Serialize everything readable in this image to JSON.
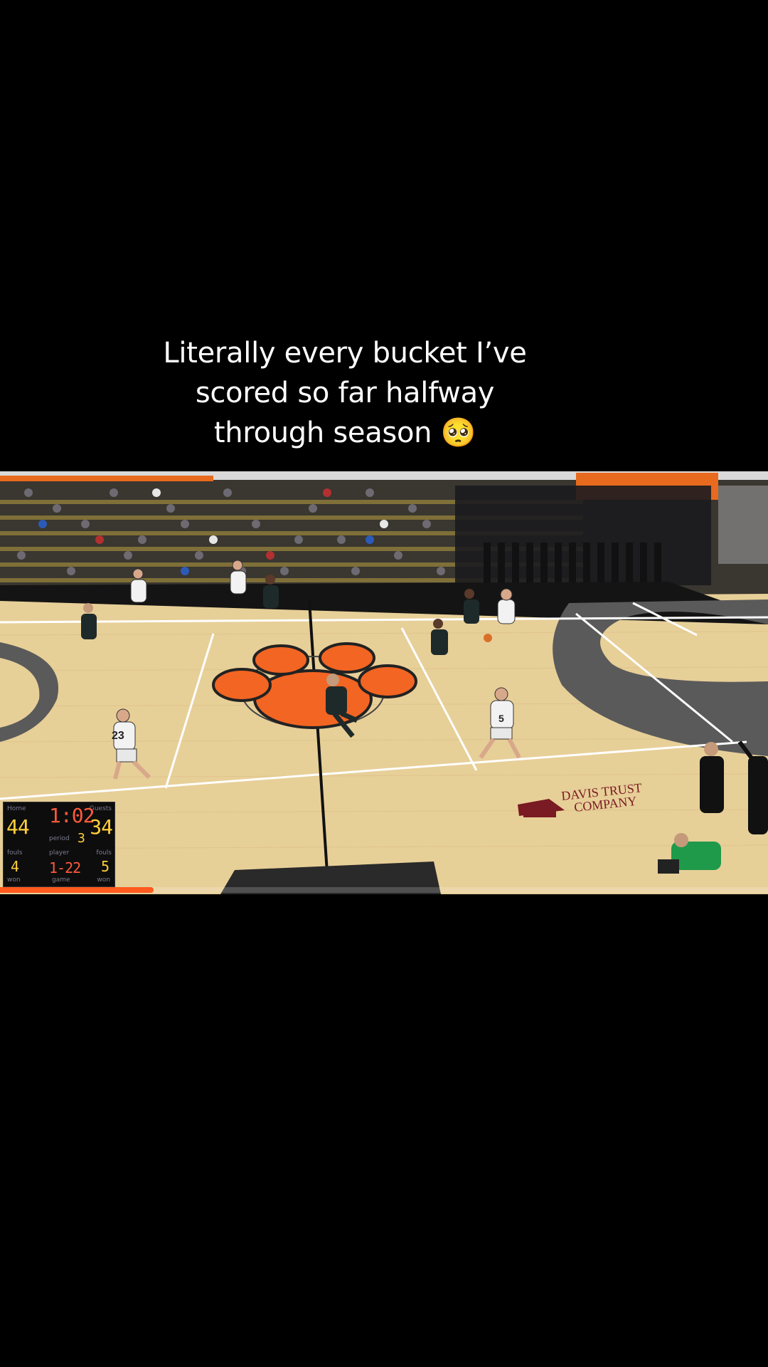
{
  "caption": {
    "line1": "Literally every bucket I’ve",
    "line2": "scored so far halfway",
    "line3": "through season 🥺"
  },
  "video": {
    "sponsor_line1": "DAVIS TRUST",
    "sponsor_line2": "COMPANY",
    "jerseys": [
      "23",
      "5"
    ],
    "scoreboard": {
      "home_label": "Home",
      "guests_label": "Guests",
      "home_score": "44",
      "guests_score": "34",
      "clock": "1:02",
      "period_label": "period",
      "period": "3",
      "fouls_label_left": "fouls",
      "fouls_label_right": "fouls",
      "player_label": "player",
      "home_fouls": "4",
      "guests_fouls": "5",
      "player_fouls": "1-22",
      "won_left": "won",
      "game_label": "game",
      "won_right": "won"
    },
    "progress": 0.2
  },
  "colors": {
    "background": "#000000",
    "court": "#e7cf98",
    "paw": "#f26522",
    "progress": "#ff5a1f"
  }
}
